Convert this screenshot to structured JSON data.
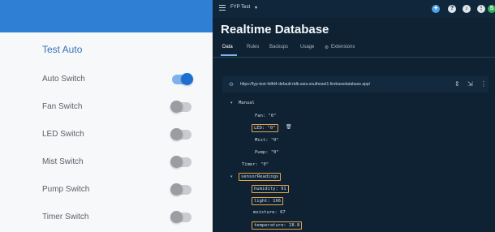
{
  "app": {
    "title": "Test Auto",
    "switches": [
      {
        "label": "Auto Switch",
        "on": true
      },
      {
        "label": "Fan Switch",
        "on": false
      },
      {
        "label": "LED Switch",
        "on": false
      },
      {
        "label": "Mist Switch",
        "on": false
      },
      {
        "label": "Pump Switch",
        "on": false
      },
      {
        "label": "Timer Switch",
        "on": false
      }
    ]
  },
  "console": {
    "project": "FYP Test",
    "title": "Realtime Database",
    "tabs": [
      "Data",
      "Rules",
      "Backups",
      "Usage",
      "Extensions"
    ],
    "url": "https://fyp-test-4dfd4-default-rtdb.asia-southeast1.firebasedatabase.app/",
    "tree": {
      "manual": {
        "key": "Manual",
        "children": [
          "Fan: \"0\"",
          "LED: \"0\"",
          "Mist: \"0\"",
          "Pump: \"0\""
        ]
      },
      "timer": "Timer: \"0\"",
      "sensor": {
        "key": "sensorReadings",
        "children": [
          "humidity: 91",
          "light: 166",
          "moisture: 67",
          "temperature: 28.8"
        ]
      }
    },
    "colors": {
      "accent": "#e7a24a",
      "background": "#0f2233",
      "header": "#2f7fd4"
    },
    "icons": [
      "menu-icon",
      "help-icon",
      "bell-icon",
      "avatar-icon",
      "link-icon",
      "expand-icon",
      "collapse-icon",
      "more-icon",
      "trash-icon"
    ]
  }
}
